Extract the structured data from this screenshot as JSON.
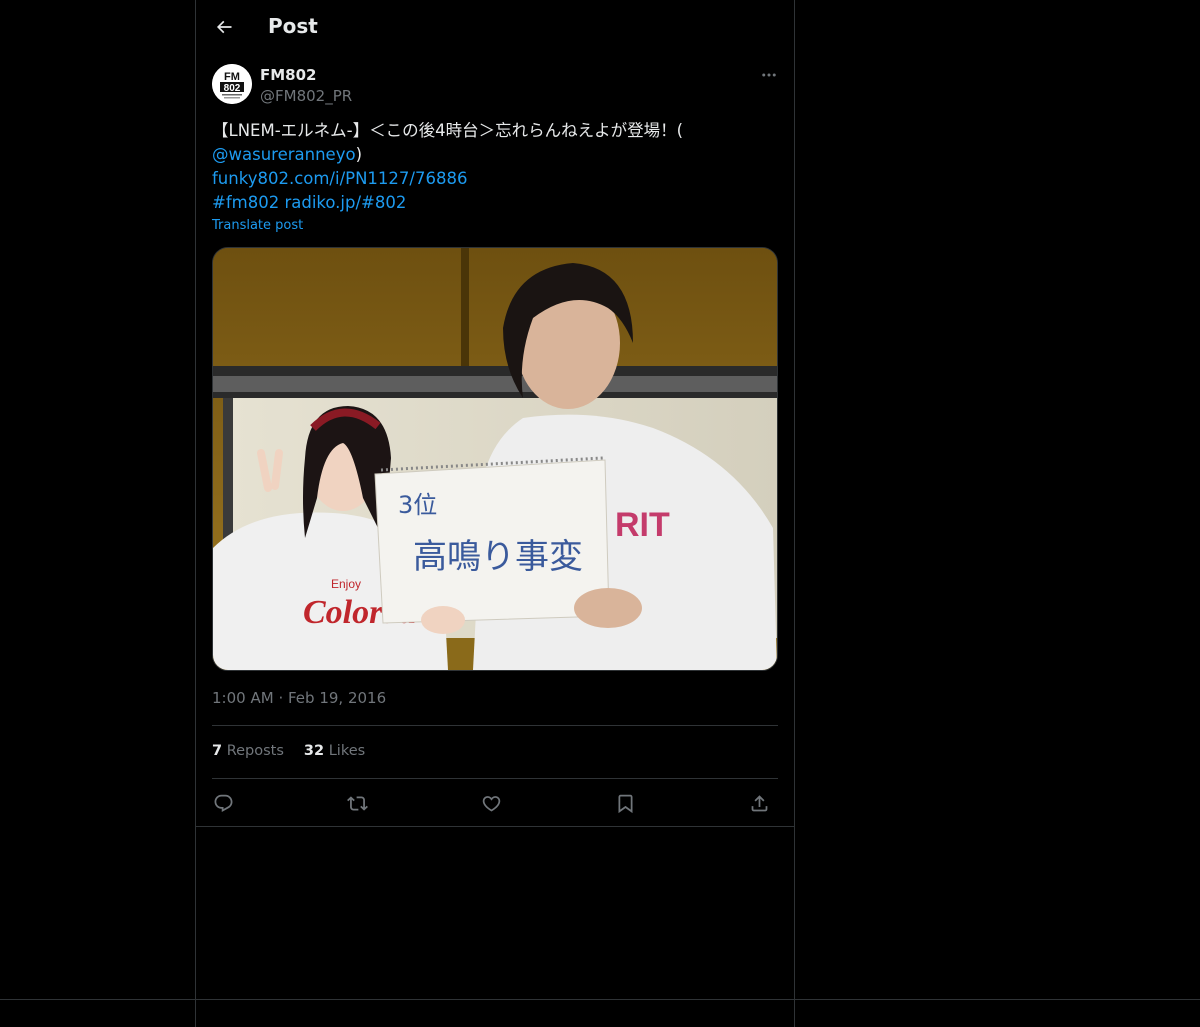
{
  "header": {
    "title": "Post",
    "back_icon": "arrow-left-icon"
  },
  "author": {
    "name": "FM802",
    "handle": "@FM802_PR",
    "avatar_text": "FM 802"
  },
  "tweet": {
    "line1": "【LNEM-エルネム-】＜この後4時台＞忘れらんねえよが登場！(",
    "mention": "@wasureranneyo",
    "mention_close": ")",
    "url1": "funky802.com/i/PN1127/76886",
    "hashtag": "#fm802",
    "url2": "radiko.jp/#802",
    "translate_label": "Translate post"
  },
  "media": {
    "sign_line1": "3位",
    "sign_line2": "高鳴り事変",
    "shirt_text": "RIT",
    "sweater_text_small": "Enjoy",
    "sweater_text_large": "Colorad"
  },
  "meta": {
    "time": "1:00 AM",
    "separator": "·",
    "date": "Feb 19, 2016"
  },
  "stats": {
    "reposts_count": "7",
    "reposts_label": "Reposts",
    "likes_count": "32",
    "likes_label": "Likes"
  },
  "colors": {
    "background": "#000000",
    "text": "#e7e9ea",
    "muted": "#71767b",
    "accent": "#1d9bf0",
    "border": "#2f3336"
  }
}
